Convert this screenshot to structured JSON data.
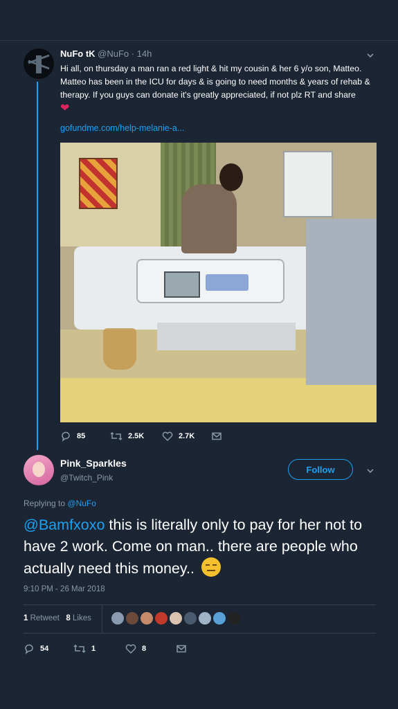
{
  "original_tweet": {
    "name": "NuFo tK",
    "handle": "@NuFo",
    "age": "14h",
    "meta": "@NuFo · 14h",
    "text": "Hi all, on thursday a man ran a red light & hit my cousin & her 6 y/o son, Matteo. Matteo has been in the ICU for days & is going to need months & years of rehab & therapy. If you guys can donate it's greatly appreciated, if not plz RT and share",
    "heart_emoji": "❤",
    "link": "gofundme.com/help-melanie-a...",
    "actions": {
      "replies": "85",
      "retweets": "2.5K",
      "likes": "2.7K"
    }
  },
  "reply_tweet": {
    "name": "Pink_Sparkles",
    "handle": "@Twitch_Pink",
    "follow_label": "Follow",
    "replying_prefix": "Replying to",
    "replying_to": "@NuFo",
    "mention": "@Bamfxoxo",
    "text": " this is literally only to pay for her not to have 2 work. Come on man.. there are people who actually need this money.. ",
    "emoji": "expressionless-face",
    "timestamp": "9:10 PM - 26 Mar 2018",
    "stats": {
      "retweet_count": "1",
      "retweet_label": "Retweet",
      "like_count": "8",
      "like_label": "Likes"
    },
    "actions": {
      "replies": "54",
      "retweets": "1",
      "likes": "8"
    }
  },
  "colors": {
    "background": "#1c2533",
    "accent": "#1da1f2",
    "muted": "#8899a6",
    "heart": "#e0245e"
  },
  "likers": [
    {
      "color": "#8a9bb0"
    },
    {
      "color": "#6b4a3a"
    },
    {
      "color": "#c48a6a"
    },
    {
      "color": "#c0392b"
    },
    {
      "color": "#d9c3b0"
    },
    {
      "color": "#4a5a6e"
    },
    {
      "color": "#9fb3c8"
    },
    {
      "color": "#5aa0d8"
    },
    {
      "color": "#222222"
    }
  ]
}
